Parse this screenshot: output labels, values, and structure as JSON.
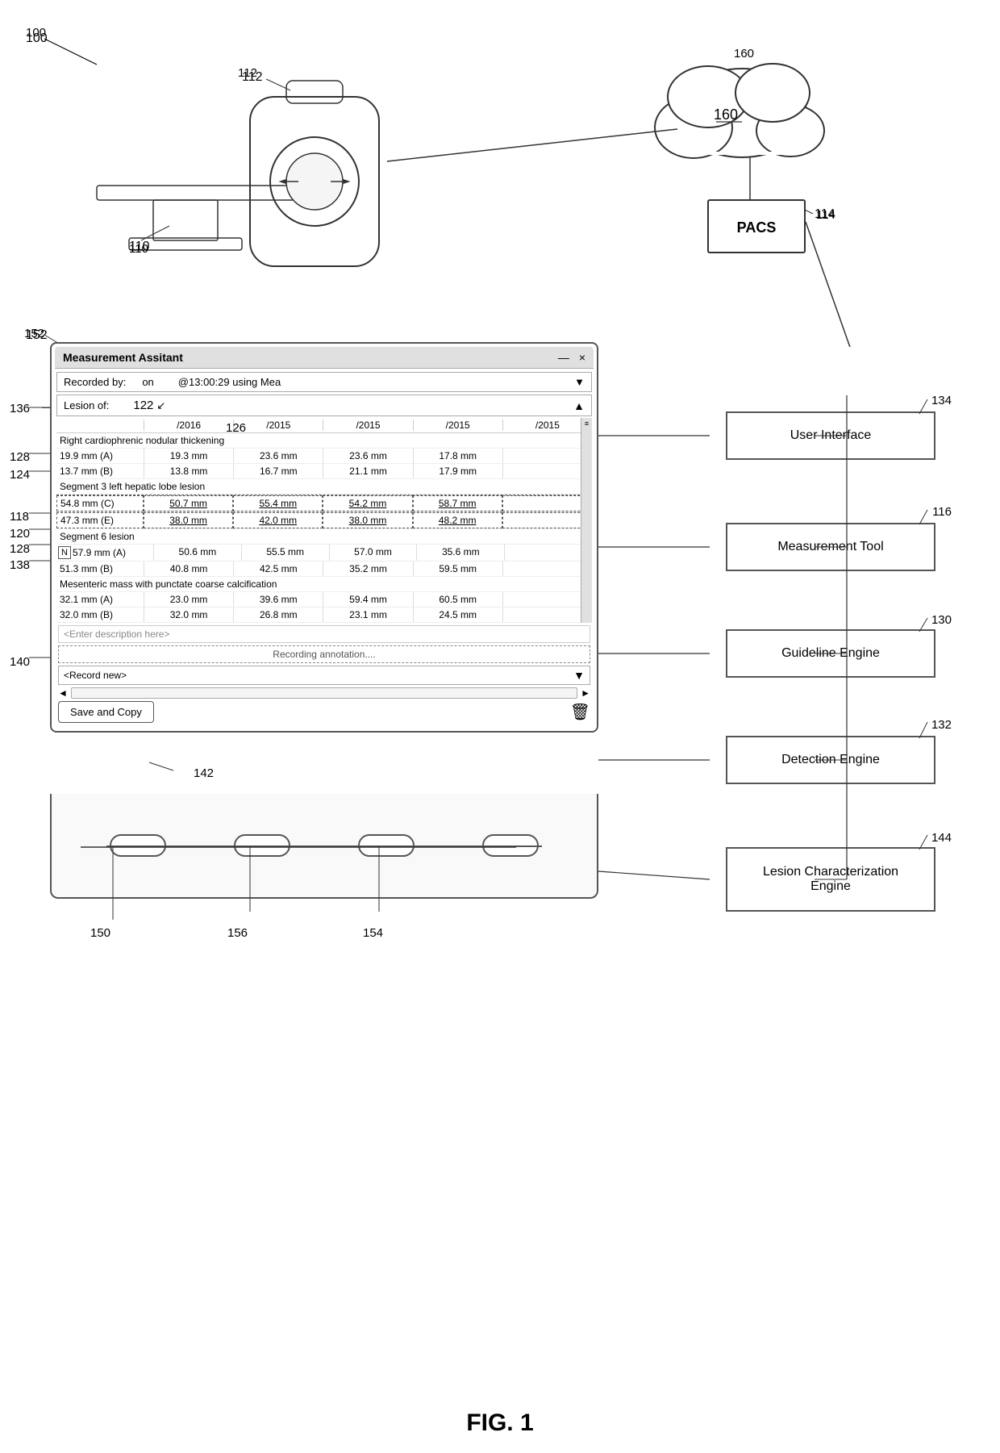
{
  "diagram": {
    "title": "FIG. 1",
    "ref_numbers": {
      "r100": "100",
      "r110": "110",
      "r112": "112",
      "r114": "114",
      "r116": "116",
      "r118": "118",
      "r120": "120",
      "r122": "122",
      "r124": "124",
      "r126": "126",
      "r128": "128",
      "r130": "130",
      "r132": "132",
      "r134": "134",
      "r136": "136",
      "r138": "138",
      "r140": "140",
      "r142": "142",
      "r144": "144",
      "r150": "150",
      "r152": "152",
      "r154": "154",
      "r156": "156",
      "r160": "160"
    },
    "pacs_label": "PACS"
  },
  "window": {
    "title": "Measurement Assitant",
    "controls": {
      "minimize": "—",
      "close": "×"
    },
    "recorded_row": {
      "label": "Recorded by:",
      "on": "on",
      "timestamp": "@13:00:29 using Mea",
      "dropdown": "▼"
    },
    "lesion_header": {
      "label": "Lesion of:",
      "ref": "122"
    },
    "date_columns": [
      "",
      "/2016",
      "/2015",
      "/2015",
      "/2015",
      "/2015"
    ],
    "sections": [
      {
        "type": "label",
        "text": "Right cardiophrenic nodular thickening"
      },
      {
        "type": "data_row",
        "col0": "19.9 mm (A)",
        "col1": "19.3 mm",
        "col2": "23.6 mm",
        "col3": "23.6 mm",
        "col4": "17.8 mm"
      },
      {
        "type": "data_row",
        "col0": "13.7 mm (B)",
        "col1": "13.8 mm",
        "col2": "16.7 mm",
        "col3": "21.1 mm",
        "col4": "17.9 mm"
      },
      {
        "type": "label",
        "text": "Segment 3 left hepatic lobe lesion"
      },
      {
        "type": "data_row_dashed",
        "col0": "54.8 mm (C)",
        "col1": "50.7 mm",
        "col2": "55.4 mm",
        "col3": "54.2 mm",
        "col4": "58.7 mm"
      },
      {
        "type": "data_row_dashed",
        "col0": "47.3 mm (E)",
        "col1": "38.0 mm",
        "col2": "42.0 mm",
        "col3": "38.0 mm",
        "col4": "48.2 mm"
      },
      {
        "type": "label",
        "text": "Segment 6 lesion"
      },
      {
        "type": "data_row_n",
        "col0": "57.9 mm (A)",
        "col1": "50.6 mm",
        "col2": "55.5 mm",
        "col3": "57.0 mm",
        "col4": "35.6 mm"
      },
      {
        "type": "data_row",
        "col0": "51.3 mm (B)",
        "col1": "40.8 mm",
        "col2": "42.5 mm",
        "col3": "35.2 mm",
        "col4": "59.5 mm"
      },
      {
        "type": "label",
        "text": "Mesenteric mass with punctate coarse calcification"
      },
      {
        "type": "data_row",
        "col0": "32.1 mm (A)",
        "col1": "23.0 mm",
        "col2": "39.6 mm",
        "col3": "59.4 mm",
        "col4": "60.5 mm"
      },
      {
        "type": "data_row",
        "col0": "32.0 mm (B)",
        "col1": "32.0 mm",
        "col2": "26.8 mm",
        "col3": "23.1 mm",
        "col4": "24.5 mm"
      }
    ],
    "description_placeholder": "<Enter description here>",
    "recording_text": "Recording annotation....",
    "record_new_text": "<Record new>",
    "save_copy_label": "Save and Copy",
    "ref_142": "142"
  },
  "right_boxes": {
    "user_interface": "User Interface",
    "measurement_tool": "Measurement Tool",
    "guideline_engine": "Guideline Engine",
    "detection_engine": "Detection Engine",
    "lesion_characterization": {
      "line1": "Lesion Characterization Engine"
    }
  },
  "bottom_connectors": {
    "left_pill": "",
    "center_left_pill": "",
    "center_right_pill": "",
    "right_pill": ""
  },
  "ref_positions": {
    "n150": "150",
    "n156": "156",
    "n154": "154"
  }
}
